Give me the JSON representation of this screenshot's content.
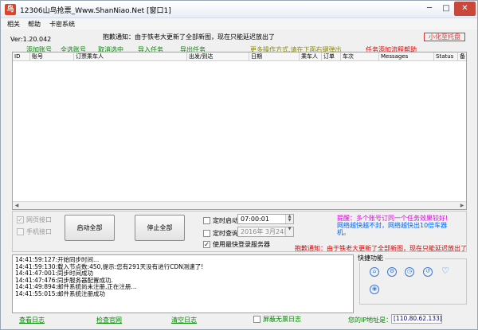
{
  "window": {
    "title": "12306山鸟抢票_Www.ShanNiao.Net  [窗口1]",
    "minimize": "─",
    "maximize": "□",
    "close": "✕"
  },
  "menu": [
    "相关",
    "帮助",
    "卡密系统"
  ],
  "version": "Ver:1.20.042",
  "notice_top": "抱歉通知：由于铁老大更新了全部新图，现在只能延迟放出了",
  "mini_tray": "小化至托盘",
  "actions": {
    "add_account": "添加账号",
    "select_all_accounts": "全选账号",
    "cancel_select": "取消选中",
    "import_tasks": "导入任务",
    "export_tasks": "导出任务",
    "more_ops": "更多操作方式,请在下面右键弹出",
    "task_help": "任务添加流程帮助"
  },
  "table": {
    "columns": [
      "ID",
      "账号",
      "订票乘车人",
      "出发/到达",
      "日期",
      "乘车人",
      "订单",
      "车次",
      "Messages",
      "Status",
      "备"
    ]
  },
  "controls": {
    "web_interface": "网页接口",
    "mobile_interface": "手机接口",
    "start_all": "启动全部",
    "stop_all": "停止全部",
    "scheduled_start": "定时启动",
    "scheduled_start_value": "07:00:01",
    "scheduled_query": "定时查询",
    "scheduled_query_value": "2016年 3月24日",
    "fastest_server": "使用最快登录服务器"
  },
  "hints": {
    "line1": "提醒：多个账号订同一个任务效果较好!",
    "line2": "网络越快越不封，网络越快出10倍车器",
    "line3": "机。"
  },
  "notice_mid": "抱歉通知：由于铁老大更新了全部新图，现在只能延迟放出了",
  "log_lines": [
    "14:41:59:127:开始同步时间...",
    "14:41:59:130:载入节点数:450,提示:您有291天没有进行CDN测速了!",
    "14:41:47:001:同步时间成功",
    "14:41:47:476:同步服务器配置成功.",
    "14:41:49:894:邮件系统尚未注册,正在注册...",
    "14:41:55:015:邮件系统注册成功"
  ],
  "quick": {
    "title": "快捷功能",
    "icons": [
      "home-icon",
      "settings-icon",
      "clock-icon",
      "history-icon",
      "heart-icon"
    ]
  },
  "footer": {
    "view_log": "查看日志",
    "check_web": "检查官网",
    "clear_log": "清空日志",
    "block_invalid": "屏蔽无票日志",
    "ip_label": "您的IP地址是：",
    "ip_value": "[110.80.62.133]"
  }
}
